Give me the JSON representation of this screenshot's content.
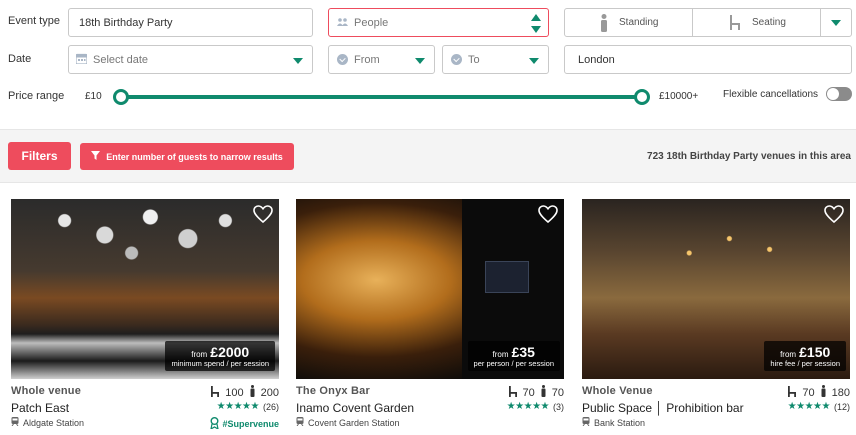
{
  "filters": {
    "event_type_label": "Event type",
    "event_type_value": "18th Birthday Party",
    "people_placeholder": "People",
    "standing_label": "Standing",
    "seating_label": "Seating",
    "date_label": "Date",
    "date_placeholder": "Select date",
    "from_placeholder": "From",
    "to_placeholder": "To",
    "location_value": "London",
    "price_range_label": "Price range",
    "price_min": "£10",
    "price_max": "£10000+",
    "price_range_start_fraction": 0.0,
    "price_range_end_fraction": 1.0,
    "flexible_label": "Flexible cancellations",
    "flexible_on": false
  },
  "toolbar": {
    "filters_button": "Filters",
    "guests_notice": "Enter number of guests to narrow results",
    "results_count": "723 18th Birthday Party venues in this area"
  },
  "colors": {
    "accent": "#0f8a6d",
    "cta": "#ee4c5d"
  },
  "venues": [
    {
      "type": "Whole venue",
      "seated": "100",
      "standing": "200",
      "name": "Patch East",
      "stars": "★★★★★",
      "reviews": "(26)",
      "station": "Aldgate Station",
      "badge": "#Supervenue",
      "price_from": "from",
      "price": "£2000",
      "price_note": "minimum spend / per session"
    },
    {
      "type": "The Onyx Bar",
      "seated": "70",
      "standing": "70",
      "name": "Inamo Covent Garden",
      "stars": "★★★★★",
      "reviews": "(3)",
      "station": "Covent Garden Station",
      "price_from": "from",
      "price": "£35",
      "price_note": "per person / per session"
    },
    {
      "type": "Whole Venue",
      "seated": "70",
      "standing": "180",
      "name": "Public Space │ Prohibition bar",
      "stars": "★★★★★",
      "reviews": "(12)",
      "station": "Bank Station",
      "price_from": "from",
      "price": "£150",
      "price_note": "hire fee / per session"
    }
  ]
}
